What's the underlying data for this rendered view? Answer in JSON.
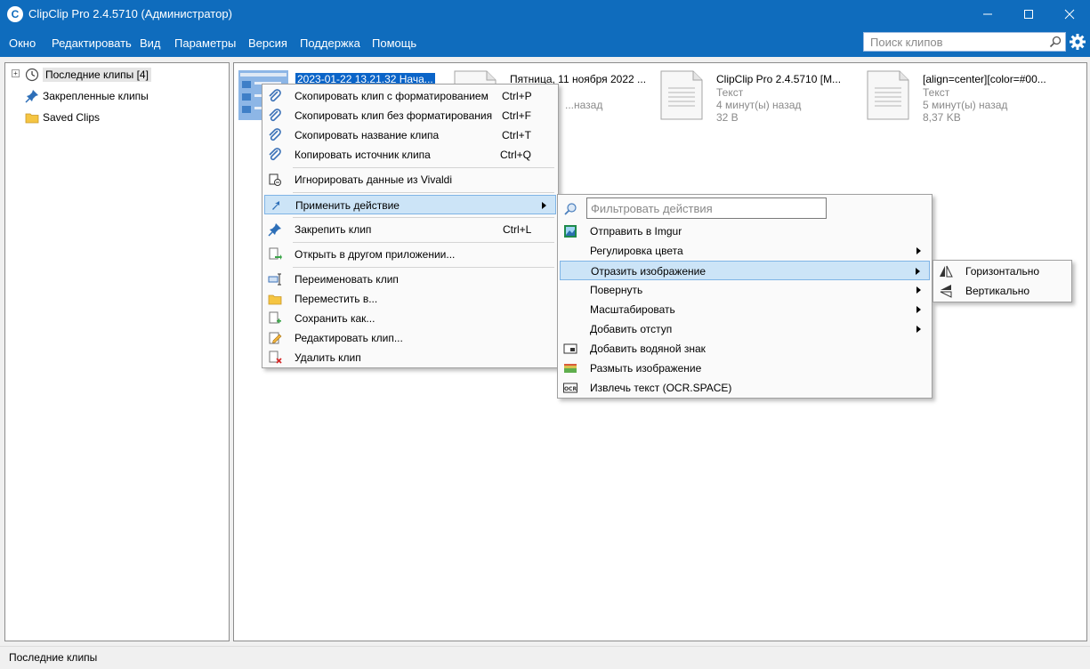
{
  "window": {
    "title": "ClipClip Pro 2.4.5710 (Администратор)",
    "app_icon_letter": "C"
  },
  "menubar": {
    "items": [
      "Окно",
      "Редактировать",
      "Вид",
      "Параметры",
      "Версия",
      "Поддержка",
      "Помощь"
    ]
  },
  "search": {
    "placeholder": "Поиск клипов"
  },
  "tree": {
    "items": [
      {
        "label": "Последние клипы [4]",
        "icon": "clock-icon",
        "expander": "+"
      },
      {
        "label": "Закрепленные клипы",
        "icon": "pin-icon"
      },
      {
        "label": "Saved Clips",
        "icon": "folder-icon"
      }
    ]
  },
  "clips": [
    {
      "name": "2023-01-22 13.21.32 Нача...",
      "type": "",
      "time": "",
      "size": ""
    },
    {
      "name": "Пятница, 11 ноября 2022 ...",
      "type": "",
      "time": "...назад",
      "size": ""
    },
    {
      "name": "ClipClip Pro 2.4.5710 [M...",
      "type": "Текст",
      "time": "4 минут(ы) назад",
      "size": "32 B"
    },
    {
      "name": "[align=center][color=#00...",
      "type": "Текст",
      "time": "5 минут(ы) назад",
      "size": "8,37 KB"
    }
  ],
  "context_menu": {
    "items": [
      {
        "label": "Скопировать клип с форматированием",
        "shortcut": "Ctrl+P"
      },
      {
        "label": "Скопировать клип без форматирования",
        "shortcut": "Ctrl+F"
      },
      {
        "label": "Скопировать название клипа",
        "shortcut": "Ctrl+T"
      },
      {
        "label": "Копировать источник клипа",
        "shortcut": "Ctrl+Q"
      },
      {
        "label": "Игнорировать данные из Vivaldi",
        "shortcut": ""
      },
      {
        "label": "Применить действие",
        "shortcut": ""
      },
      {
        "label": "Закрепить клип",
        "shortcut": "Ctrl+L"
      },
      {
        "label": "Открыть в другом приложении...",
        "shortcut": ""
      },
      {
        "label": "Переименовать клип",
        "shortcut": ""
      },
      {
        "label": "Переместить в...",
        "shortcut": ""
      },
      {
        "label": "Сохранить как...",
        "shortcut": ""
      },
      {
        "label": "Редактировать клип...",
        "shortcut": ""
      },
      {
        "label": "Удалить клип",
        "shortcut": ""
      }
    ]
  },
  "actions_menu": {
    "filter_placeholder": "Фильтровать действия",
    "items": [
      {
        "label": "Отправить в Imgur"
      },
      {
        "label": "Регулировка цвета"
      },
      {
        "label": "Отразить изображение"
      },
      {
        "label": "Повернуть"
      },
      {
        "label": "Масштабировать"
      },
      {
        "label": "Добавить отступ"
      },
      {
        "label": "Добавить водяной знак"
      },
      {
        "label": "Размыть изображение"
      },
      {
        "label": "Извлечь текст (OCR.SPACE)"
      }
    ]
  },
  "flip_menu": {
    "items": [
      {
        "label": "Горизонтально"
      },
      {
        "label": "Вертикально"
      }
    ]
  },
  "statusbar": {
    "text": "Последние клипы"
  },
  "colors": {
    "titlebar": "#0f6cbd",
    "highlight": "#cce4f7",
    "selection": "#0a64c8"
  }
}
